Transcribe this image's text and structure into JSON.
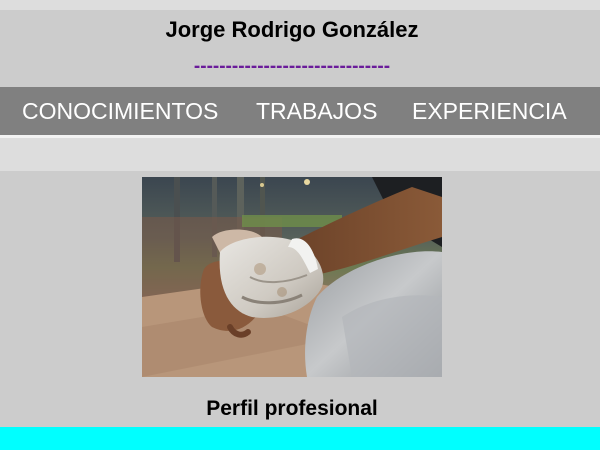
{
  "header": {
    "name": "Jorge Rodrigo González",
    "separator": "-------------------------------"
  },
  "nav": {
    "items": [
      {
        "label": "CONOCIMIENTOS"
      },
      {
        "label": "TRABAJOS"
      },
      {
        "label": "EXPERIENCIA"
      }
    ]
  },
  "main": {
    "photo_subject": "baseball-player-hands-with-batting-gloves",
    "section_title": "Perfil profesional"
  },
  "colors": {
    "background": "#dddddd",
    "panel": "#cccccc",
    "nav_background": "#808080",
    "separator": "#6a1b9a",
    "footer_bar": "#00ffff"
  }
}
